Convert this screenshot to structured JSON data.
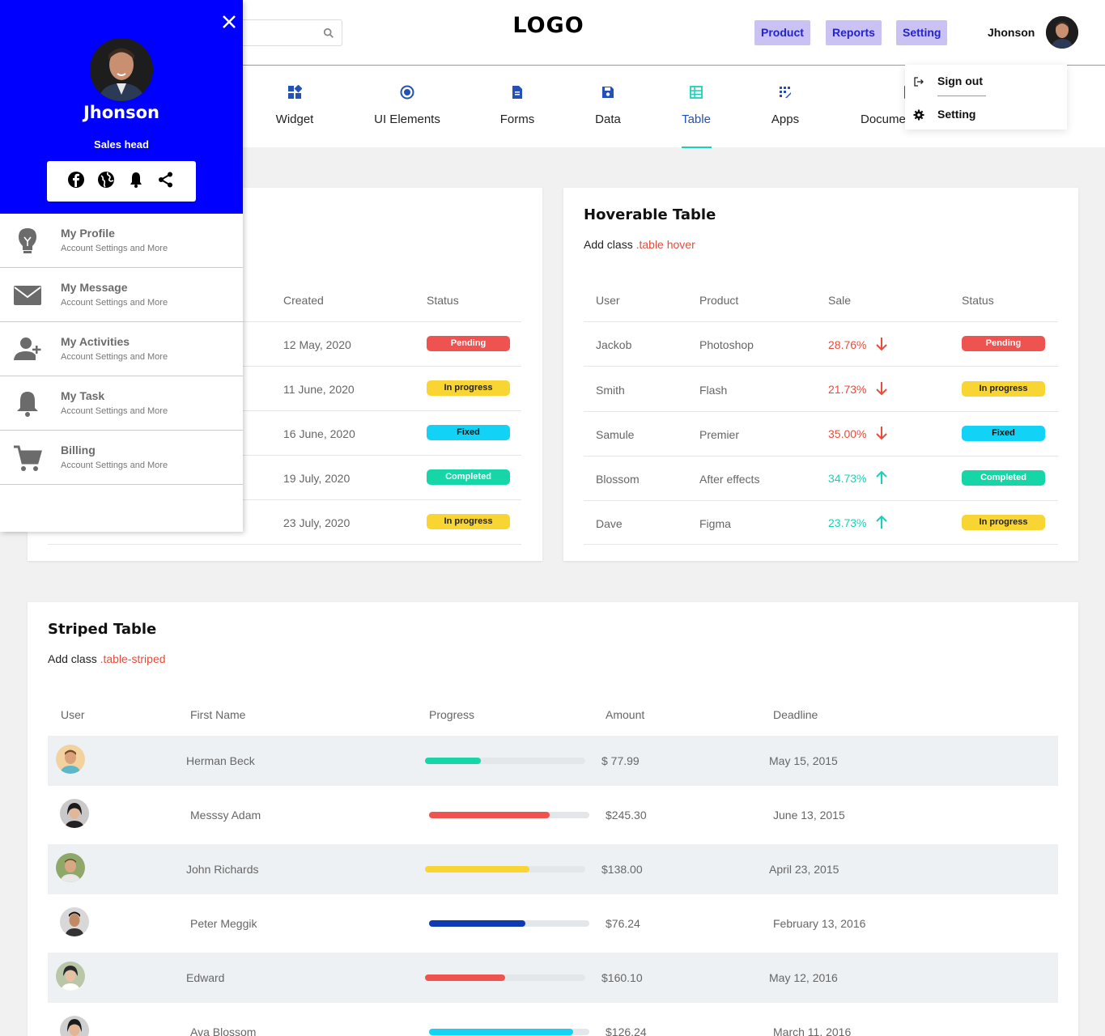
{
  "header": {
    "logo": "LOGO",
    "buttons": [
      "Product",
      "Reports",
      "Setting"
    ],
    "user_name": "Jhonson"
  },
  "dropdown": {
    "items": [
      {
        "label": "Sign out",
        "icon": "sign-out-icon"
      },
      {
        "label": "Setting",
        "icon": "gear-icon"
      }
    ]
  },
  "nav": {
    "items": [
      {
        "label": "Widget",
        "icon": "widget-icon"
      },
      {
        "label": "UI Elements",
        "icon": "target-icon"
      },
      {
        "label": "Forms",
        "icon": "document-icon"
      },
      {
        "label": "Data",
        "icon": "floppy-icon"
      },
      {
        "label": "Table",
        "icon": "table-icon",
        "active": true
      },
      {
        "label": "Apps",
        "icon": "apps-icon"
      },
      {
        "label": "Docume",
        "icon": "docs-icon"
      }
    ]
  },
  "sidebar": {
    "name": "Jhonson",
    "role": "Sales head",
    "social": [
      "facebook-icon",
      "globe-icon",
      "bell-icon",
      "share-icon"
    ],
    "items": [
      {
        "label": "My Profile",
        "desc": "Account Settings and More",
        "icon": "lightbulb-icon"
      },
      {
        "label": "My Message",
        "desc": "Account Settings and More",
        "icon": "envelope-icon"
      },
      {
        "label": "My Activities",
        "desc": "Account Settings and More",
        "icon": "add-user-icon"
      },
      {
        "label": "My Task",
        "desc": "Account Settings and More",
        "icon": "bell-icon"
      },
      {
        "label": "Billing",
        "desc": "Account Settings and More",
        "icon": "cart-icon"
      }
    ]
  },
  "basic_table": {
    "headers": [
      "Created",
      "Status"
    ],
    "rows": [
      {
        "created": "12 May, 2020",
        "status": "Pending"
      },
      {
        "created": "11 June, 2020",
        "status": "In progress"
      },
      {
        "created": "16 June, 2020",
        "status": "Fixed"
      },
      {
        "created": "19 July, 2020",
        "status": "Completed"
      },
      {
        "created": "23 July, 2020",
        "status": "In progress"
      }
    ]
  },
  "hover_table": {
    "title": "Hoverable Table",
    "sub_prefix": "Add class ",
    "sub_class": ".table hover",
    "headers": [
      "User",
      "Product",
      "Sale",
      "Status"
    ],
    "rows": [
      {
        "user": "Jackob",
        "product": "Photoshop",
        "sale": "28.76%",
        "dir": "down",
        "status": "Pending"
      },
      {
        "user": "Smith",
        "product": "Flash",
        "sale": "21.73%",
        "dir": "down",
        "status": "In progress"
      },
      {
        "user": "Samule",
        "product": "Premier",
        "sale": "35.00%",
        "dir": "down",
        "status": "Fixed"
      },
      {
        "user": "Blossom",
        "product": "After effects",
        "sale": "34.73%",
        "dir": "up",
        "status": "Completed"
      },
      {
        "user": "Dave",
        "product": "Figma",
        "sale": "23.73%",
        "dir": "up",
        "status": "In progress"
      }
    ]
  },
  "striped_table": {
    "title": "Striped Table",
    "sub_prefix": "Add class ",
    "sub_class": ".table-striped",
    "headers": [
      "User",
      "First Name",
      "Progress",
      "Amount",
      "Deadline"
    ],
    "rows": [
      {
        "name": "Herman Beck",
        "progress": 0.35,
        "color": "#16d6a8",
        "amount": "$ 77.99",
        "deadline": "May 15, 2015"
      },
      {
        "name": "Messsy Adam",
        "progress": 0.75,
        "color": "#ef5350",
        "amount": "$245.30",
        "deadline": "June 13, 2015"
      },
      {
        "name": "John Richards",
        "progress": 0.65,
        "color": "#f9d533",
        "amount": "$138.00",
        "deadline": "April 23, 2015"
      },
      {
        "name": "Peter Meggik",
        "progress": 0.6,
        "color": "#0d3bb3",
        "amount": "$76.24",
        "deadline": "February 13, 2016"
      },
      {
        "name": "Edward",
        "progress": 0.5,
        "color": "#ef5350",
        "amount": "$160.10",
        "deadline": "May 12, 2016"
      },
      {
        "name": "Ava Blossom",
        "progress": 0.9,
        "color": "#12d3f5",
        "amount": "$126.24",
        "deadline": "March 11, 2016"
      }
    ]
  },
  "colors": {
    "brand_blue": "#0000ff",
    "accent_teal": "#1ad1b7",
    "danger": "#ef5350"
  }
}
